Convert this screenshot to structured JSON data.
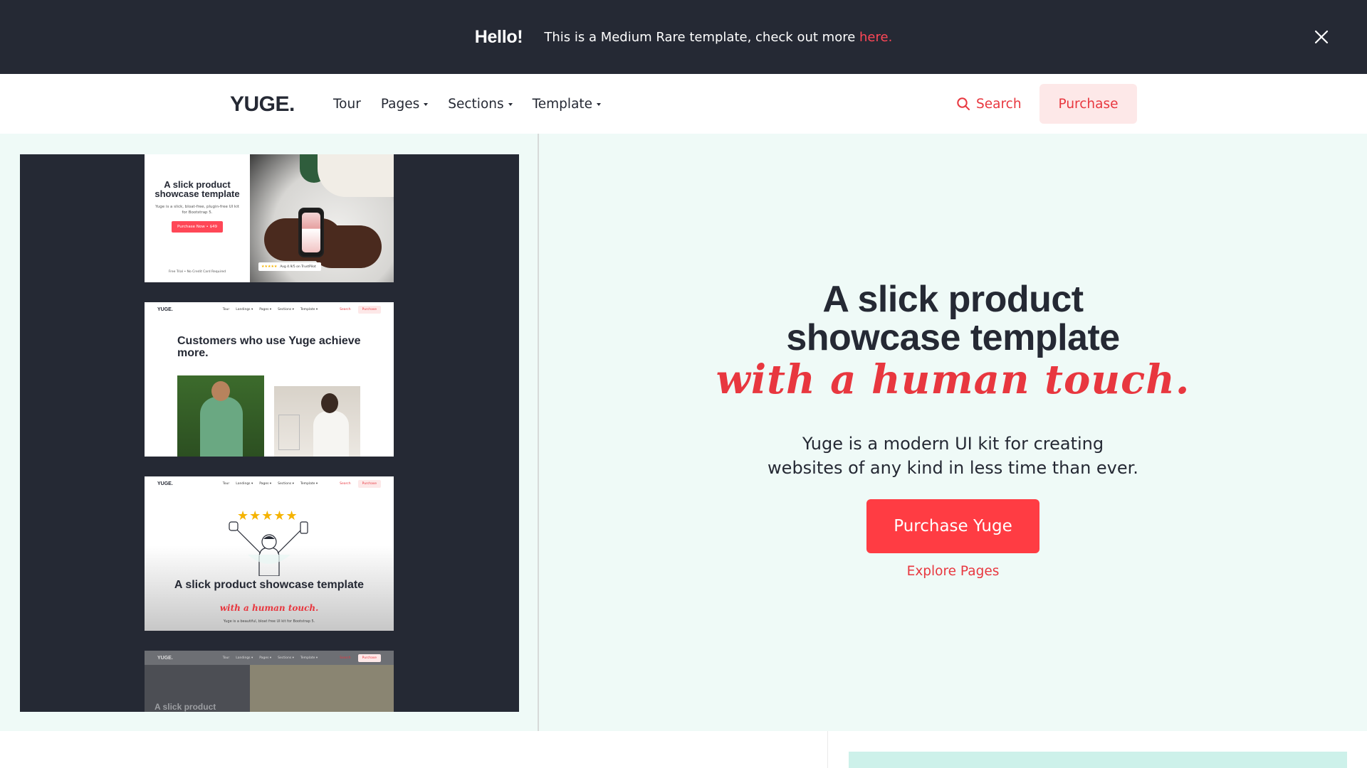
{
  "announcement": {
    "hello": "Hello!",
    "message": "This is a Medium Rare template, check out more ",
    "link": "here.",
    "close_icon": "close-icon"
  },
  "navbar": {
    "logo": "YUGE.",
    "links": [
      {
        "label": "Tour",
        "dropdown": false
      },
      {
        "label": "Pages",
        "dropdown": true
      },
      {
        "label": "Sections",
        "dropdown": true
      },
      {
        "label": "Template",
        "dropdown": true
      }
    ],
    "search_label": "Search",
    "purchase_label": "Purchase"
  },
  "gallery": {
    "thumb1": {
      "title": "A slick product showcase template",
      "subtitle": "Yuge is a slick, bloat-free, plugin-free UI kit for Bootstrap 5.",
      "cta": "Purchase Now • $49",
      "footer": "Free Trial • No Credit Card Required",
      "rating_stars": "★★★★★",
      "rating_text": "Avg 4.9/5 on TrustPilot"
    },
    "mininav": {
      "logo": "YUGE.",
      "links": [
        "Tour",
        "Landings ▾",
        "Pages ▾",
        "Sections ▾",
        "Template ▾"
      ],
      "search": "Search",
      "purchase": "Purchase"
    },
    "mininav4": {
      "links": [
        "Tour",
        "Landings ▾",
        "Pages ▾",
        "Sections ▾",
        "Template ▾"
      ]
    },
    "thumb2": {
      "title": "Customers who use Yuge achieve more."
    },
    "thumb3": {
      "stars": "★★★★★",
      "title": "A slick product showcase template",
      "script": "with a human touch.",
      "subtitle": "Yuge is a beautiful, bloat free UI kit for Bootstrap 5."
    },
    "thumb4": {
      "title": "A slick product"
    }
  },
  "hero": {
    "headline_line1": "A slick product",
    "headline_line2": "showcase template",
    "script": "with a human touch.",
    "lead_line1": "Yuge is a modern UI kit for creating",
    "lead_line2": "websites of any kind in less time than ever.",
    "cta": "Purchase Yuge",
    "secondary": "Explore Pages"
  },
  "colors": {
    "dark": "#252934",
    "accent": "#ff3c43",
    "mint": "#effaf7"
  }
}
